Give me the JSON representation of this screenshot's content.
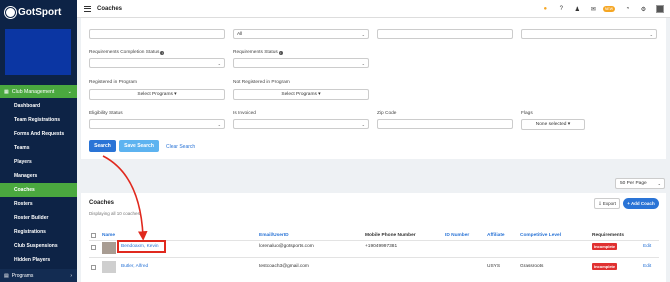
{
  "brand": {
    "name": "GotSport"
  },
  "sidebar": {
    "section_label": "Club Management",
    "items": [
      {
        "label": "Dashboard"
      },
      {
        "label": "Team Registrations"
      },
      {
        "label": "Forms And Requests"
      },
      {
        "label": "Teams"
      },
      {
        "label": "Players"
      },
      {
        "label": "Managers"
      },
      {
        "label": "Coaches",
        "active": true
      },
      {
        "label": "Rosters"
      },
      {
        "label": "Roster Builder"
      },
      {
        "label": "Registrations"
      },
      {
        "label": "Club Suspensions"
      },
      {
        "label": "Hidden Players"
      }
    ],
    "bottom_label": "Programs"
  },
  "topbar": {
    "title": "Coaches",
    "new_badge": "NEW"
  },
  "filters": {
    "top_row": {
      "email_value": "",
      "role_value": "All",
      "completed_value": "",
      "not_completed_value": ""
    },
    "requirements_completion_status": {
      "label": "Requirements Completion Status",
      "value": ""
    },
    "requirements_status": {
      "label": "Requirements Status",
      "value": ""
    },
    "registered_in_program": {
      "label": "Registered in Program",
      "button": "Select Programs ▾"
    },
    "not_registered_in_program": {
      "label": "Not Registered in Program",
      "button": "Select Programs ▾"
    },
    "eligibility_status": {
      "label": "Eligibility Status",
      "value": ""
    },
    "is_invoiced": {
      "label": "Is Invoiced",
      "value": ""
    },
    "zip_code": {
      "label": "Zip Code",
      "value": ""
    },
    "flags": {
      "label": "Flags",
      "button": "None selected ▾"
    },
    "search_button": "Search",
    "save_search_button": "Save Search",
    "clear_search_link": "Clear Search"
  },
  "per_page": "50 Per Page",
  "coaches": {
    "title": "Coaches",
    "subtitle": "Displaying all 10 coaches",
    "export_button": "Export",
    "add_button": "Add Coach",
    "columns": [
      "Name",
      "Email/UserID",
      "Mobile Phone Number",
      "ID Number",
      "Affiliate",
      "Competitive Level",
      "Requirements"
    ],
    "rows": [
      {
        "name": "Bendoaxm, Kevin",
        "email": "lorenaluo@gotsports.com",
        "phone": "+19049997381",
        "id_number": "",
        "affiliate": "",
        "level": "",
        "requirements": "Incomplete",
        "action": "Edit"
      },
      {
        "name": "Butler, Alfred",
        "email": "testcoach3@gmail.com",
        "phone": "",
        "id_number": "",
        "affiliate": "USYS",
        "level": "Grassroots",
        "requirements": "Incomplete",
        "action": "Edit"
      }
    ]
  },
  "colors": {
    "sidebar": "#0d2346",
    "accent_green": "#4aa83f",
    "link_blue": "#2a74d6",
    "badge_red": "#e03131",
    "annotation_red": "#e0291e"
  },
  "icons": [
    "hamburger-icon",
    "coin-icon",
    "question-icon",
    "user-icon",
    "mail-icon",
    "chat-icon",
    "gear-icon",
    "info-icon",
    "checkbox-icon",
    "chevron-down-icon",
    "chevron-right-icon",
    "export-icon",
    "plus-icon"
  ]
}
